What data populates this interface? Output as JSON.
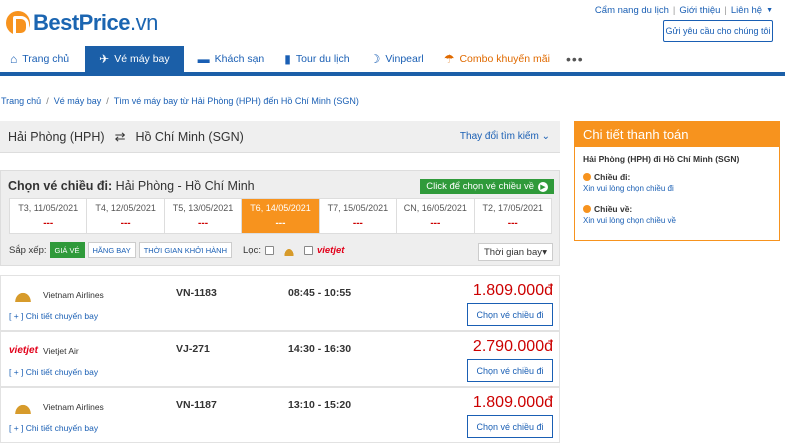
{
  "header": {
    "logo_brand": "BestPrice",
    "logo_tld": ".vn",
    "links": [
      "Cẩm nang du lịch",
      "Giới thiệu",
      "Liên hệ"
    ],
    "support_button": "Gửi yêu cầu cho chúng tôi"
  },
  "nav": {
    "items": [
      {
        "label": "Trang chủ",
        "icon": "home-icon"
      },
      {
        "label": "Vé máy bay",
        "icon": "plane-icon"
      },
      {
        "label": "Khách sạn",
        "icon": "bed-icon"
      },
      {
        "label": "Tour du lịch",
        "icon": "luggage-icon"
      },
      {
        "label": "Vinpearl",
        "icon": "vinpearl-icon"
      },
      {
        "label": "Combo khuyến mãi",
        "icon": "beach-icon"
      }
    ],
    "more": "•••"
  },
  "breadcrumb": [
    "Trang chủ",
    "Vé máy bay",
    "Tìm vé máy bay từ Hải Phòng (HPH) đến Hồ Chí Minh (SGN)"
  ],
  "route": {
    "from": "Hải Phòng (HPH)",
    "to": "Hồ Chí Minh (SGN)",
    "change_search": "Thay đổi tìm kiếm"
  },
  "choose": {
    "title_prefix": "Chọn vé chiều đi:",
    "title_route": "Hải Phòng - Hồ Chí Minh",
    "click_button": "Click để chọn vé chiều về",
    "dates": [
      {
        "label": "T3, 11/05/2021",
        "price": "---"
      },
      {
        "label": "T4, 12/05/2021",
        "price": "---"
      },
      {
        "label": "T5, 13/05/2021",
        "price": "---"
      },
      {
        "label": "T6, 14/05/2021",
        "price": "---"
      },
      {
        "label": "T7, 15/05/2021",
        "price": "---"
      },
      {
        "label": "CN, 16/05/2021",
        "price": "---"
      },
      {
        "label": "T2, 17/05/2021",
        "price": "---"
      }
    ],
    "active_date_index": 3,
    "sort_label": "Sắp xếp:",
    "sort_buttons": [
      "GIÁ VÉ",
      "HÃNG BAY",
      "THỜI GIAN KHỞI HÀNH"
    ],
    "filter_label": "Lọc:",
    "filter_vietjet": "vietjet",
    "sort_select": "Thời gian bay"
  },
  "flights": [
    {
      "airline": "Vietnam Airlines",
      "code": "VN-1183",
      "time": "08:45 - 10:55",
      "price": "1.809.000đ",
      "details": "[ + ] Chi tiết chuyến bay",
      "button": "Chọn vé chiều đi"
    },
    {
      "airline": "Vietjet Air",
      "code": "VJ-271",
      "time": "14:30 - 16:30",
      "price": "2.790.000đ",
      "details": "[ + ] Chi tiết chuyến bay",
      "button": "Chọn vé chiều đi"
    },
    {
      "airline": "Vietnam Airlines",
      "code": "VN-1187",
      "time": "13:10 - 15:20",
      "price": "1.809.000đ",
      "details": "[ + ] Chi tiết chuyến bay",
      "button": "Chọn vé chiều đi"
    }
  ],
  "payment": {
    "title": "Chi tiết thanh toán",
    "route": "Hải Phòng (HPH) đi Hồ Chí Minh (SGN)",
    "outbound_label": "Chiều đi:",
    "outbound_msg": "Xin vui lòng chọn chiều đi",
    "return_label": "Chiều về:",
    "return_msg": "Xin vui lòng chọn chiều về"
  },
  "colors": {
    "brand_blue": "#1b5fa8",
    "accent_orange": "#f7931e",
    "price_red": "#cc0000",
    "green": "#2f9a3a"
  }
}
